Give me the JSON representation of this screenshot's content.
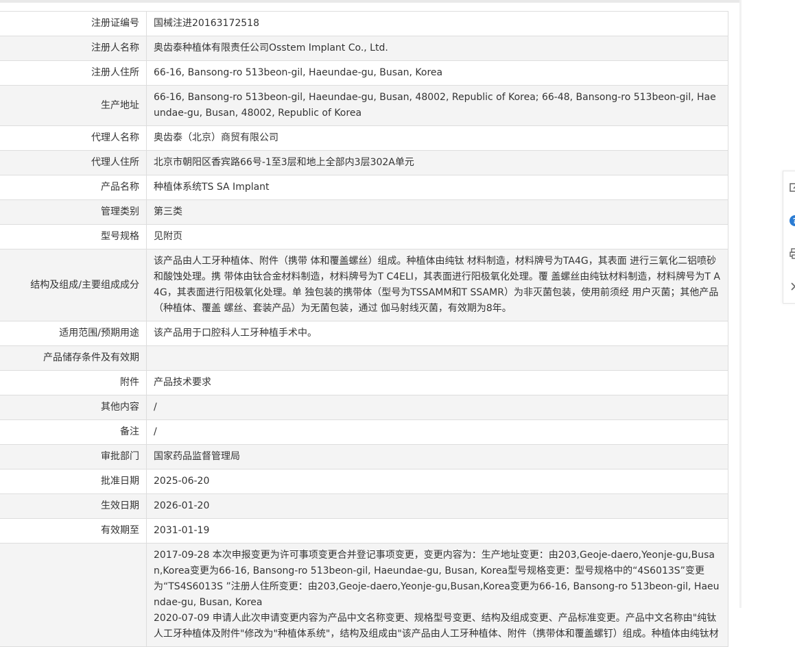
{
  "rows": [
    {
      "label": "注册证编号",
      "value": "国械注进20163172518"
    },
    {
      "label": "注册人名称",
      "value": "奥齿泰种植体有限责任公司Osstem Implant Co., Ltd."
    },
    {
      "label": "注册人住所",
      "value": "66-16, Bansong-ro 513beon-gil, Haeundae-gu, Busan, Korea"
    },
    {
      "label": "生产地址",
      "value": "66-16, Bansong-ro 513beon-gil, Haeundae-gu, Busan, 48002, Republic of Korea; 66-48, Bansong-ro 513beon-gil, Haeundae-gu, Busan, 48002, Republic of Korea"
    },
    {
      "label": "代理人名称",
      "value": "奥齿泰（北京）商贸有限公司"
    },
    {
      "label": "代理人住所",
      "value": "北京市朝阳区香宾路66号-1至3层和地上全部内3层302A单元"
    },
    {
      "label": "产品名称",
      "value": "种植体系统TS SA Implant"
    },
    {
      "label": "管理类别",
      "value": "第三类"
    },
    {
      "label": "型号规格",
      "value": "见附页"
    },
    {
      "label": "结构及组成/主要组成成分",
      "value": "该产品由人工牙种植体、附件（携带 体和覆盖螺丝）组成。种植体由纯钛 材料制造，材料牌号为TA4G，其表面 进行三氧化二铝喷砂和酸蚀处理。携 带体由钛合金材料制造，材料牌号为T C4ELI，其表面进行阳极氧化处理。覆 盖螺丝由纯钛材料制造，材料牌号为T A4G，其表面进行阳极氧化处理。单 独包装的携带体（型号为TSSAMM和T SSAMR）为非灭菌包装，使用前须经 用户灭菌；其他产品（种植体、覆盖 螺丝、套装产品）为无菌包装，通过 伽马射线灭菌，有效期为8年。"
    },
    {
      "label": "适用范围/预期用途",
      "value": "该产品用于口腔科人工牙种植手术中。"
    },
    {
      "label": "产品储存条件及有效期",
      "value": ""
    },
    {
      "label": "附件",
      "value": "产品技术要求"
    },
    {
      "label": "其他内容",
      "value": "/"
    },
    {
      "label": "备注",
      "value": "/"
    },
    {
      "label": "审批部门",
      "value": "国家药品监督管理局"
    },
    {
      "label": "批准日期",
      "value": "2025-06-20"
    },
    {
      "label": "生效日期",
      "value": "2026-01-20"
    },
    {
      "label": "有效期至",
      "value": "2031-01-19"
    }
  ],
  "change_history": {
    "label": "",
    "entries": [
      "2017-09-28 本次申报变更为许可事项变更合并登记事项变更，变更内容为：生产地址变更：由203,Geoje-daero,Yeonje-gu,Busan,Korea变更为66-16, Bansong-ro 513beon-gil, Haeundae-gu, Busan, Korea型号规格变更：型号规格中的“4S6013S”变更为“TS4S6013S ”注册人住所变更：由203,Geoje-daero,Yeonje-gu,Busan,Korea变更为66-16, Bansong-ro 513beon-gil, Haeundae-gu, Busan, Korea",
      "2020-07-09 申请人此次申请变更内容为产品中文名称变更、规格型号变更、结构及组成变更、产品标准变更。产品中文名称由\"纯钛人工牙种植体及附件\"修改为\"种植体系统\"，结构及组成由\"该产品由人工牙种植体、附件（携带体和覆盖螺钉）组成。种植体由纯钛材"
    ]
  },
  "tools": {
    "icons": [
      "edit-icon",
      "help-icon",
      "print-icon",
      "close-icon"
    ],
    "accent": "#2b7cd3",
    "icon_color": "#888888"
  }
}
